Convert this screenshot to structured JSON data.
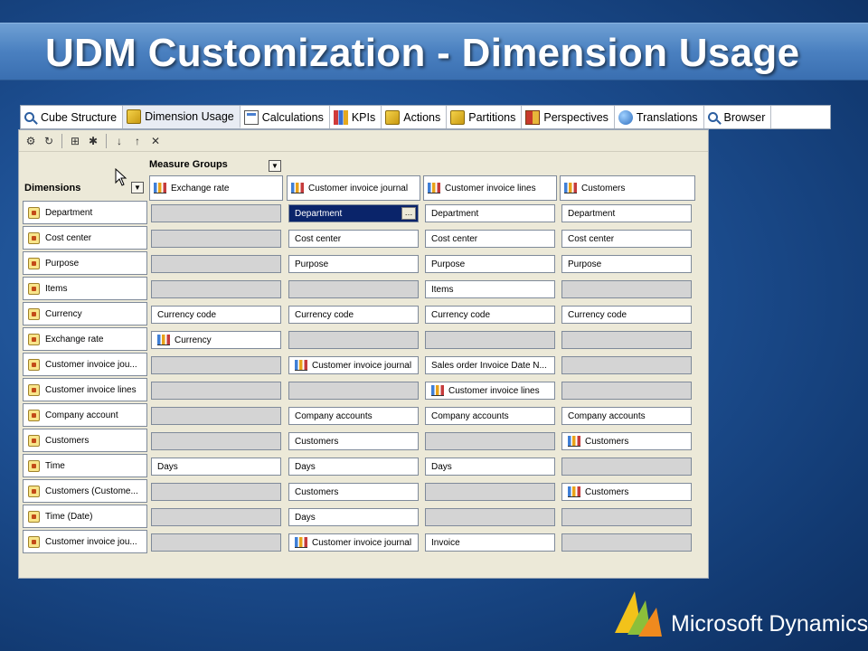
{
  "slide": {
    "title": "UDM Customization - Dimension Usage"
  },
  "tabs": [
    {
      "label": "Cube Structure",
      "icon": "cube-structure-icon"
    },
    {
      "label": "Dimension Usage",
      "icon": "dimension-usage-icon",
      "active": true
    },
    {
      "label": "Calculations",
      "icon": "calculations-icon"
    },
    {
      "label": "KPIs",
      "icon": "kpis-icon"
    },
    {
      "label": "Actions",
      "icon": "actions-icon"
    },
    {
      "label": "Partitions",
      "icon": "partitions-icon"
    },
    {
      "label": "Perspectives",
      "icon": "perspectives-icon"
    },
    {
      "label": "Translations",
      "icon": "translations-icon"
    },
    {
      "label": "Browser",
      "icon": "browser-icon"
    }
  ],
  "grid": {
    "measure_groups_label": "Measure Groups",
    "dimensions_label": "Dimensions",
    "columns": [
      "Exchange rate",
      "Customer invoice journal",
      "Customer invoice lines",
      "Customers"
    ],
    "rows": [
      {
        "dimension": "Department",
        "cells": [
          null,
          "Department",
          "Department",
          "Department"
        ]
      },
      {
        "dimension": "Cost center",
        "cells": [
          null,
          "Cost center",
          "Cost center",
          "Cost center"
        ]
      },
      {
        "dimension": "Purpose",
        "cells": [
          null,
          "Purpose",
          "Purpose",
          "Purpose"
        ]
      },
      {
        "dimension": "Items",
        "cells": [
          null,
          null,
          "Items",
          null
        ]
      },
      {
        "dimension": "Currency",
        "cells": [
          "Currency code",
          "Currency code",
          "Currency code",
          "Currency code"
        ]
      },
      {
        "dimension": "Exchange rate",
        "cells": [
          "Currency",
          null,
          null,
          null
        ]
      },
      {
        "dimension": "Customer invoice jou...",
        "cells": [
          null,
          "Customer invoice journal",
          "Sales order Invoice Date N...",
          null
        ]
      },
      {
        "dimension": "Customer invoice lines",
        "cells": [
          null,
          null,
          "Customer invoice lines",
          null
        ]
      },
      {
        "dimension": "Company account",
        "cells": [
          null,
          "Company accounts",
          "Company accounts",
          "Company accounts"
        ]
      },
      {
        "dimension": "Customers",
        "cells": [
          null,
          "Customers",
          null,
          "Customers"
        ]
      },
      {
        "dimension": "Time",
        "cells": [
          "Days",
          "Days",
          "Days",
          null
        ]
      },
      {
        "dimension": "Customers (Custome...",
        "cells": [
          null,
          "Customers",
          null,
          "Customers"
        ]
      },
      {
        "dimension": "Time (Date)",
        "cells": [
          null,
          "Days",
          null,
          null
        ]
      },
      {
        "dimension": "Customer invoice jou...",
        "cells": [
          null,
          "Customer invoice journal",
          "Invoice",
          null
        ]
      }
    ],
    "fact_cells": [
      [
        5,
        0
      ],
      [
        6,
        1
      ],
      [
        7,
        2
      ],
      [
        9,
        3
      ],
      [
        11,
        3
      ],
      [
        13,
        1
      ]
    ],
    "selected_cell": [
      0,
      1
    ]
  },
  "logo": {
    "text": "Microsoft Dynamics",
    "trademark": "®"
  },
  "colors": {
    "selection": "#0a246a",
    "empty_cell": "#d4d4d4",
    "panel": "#ece9d8"
  }
}
